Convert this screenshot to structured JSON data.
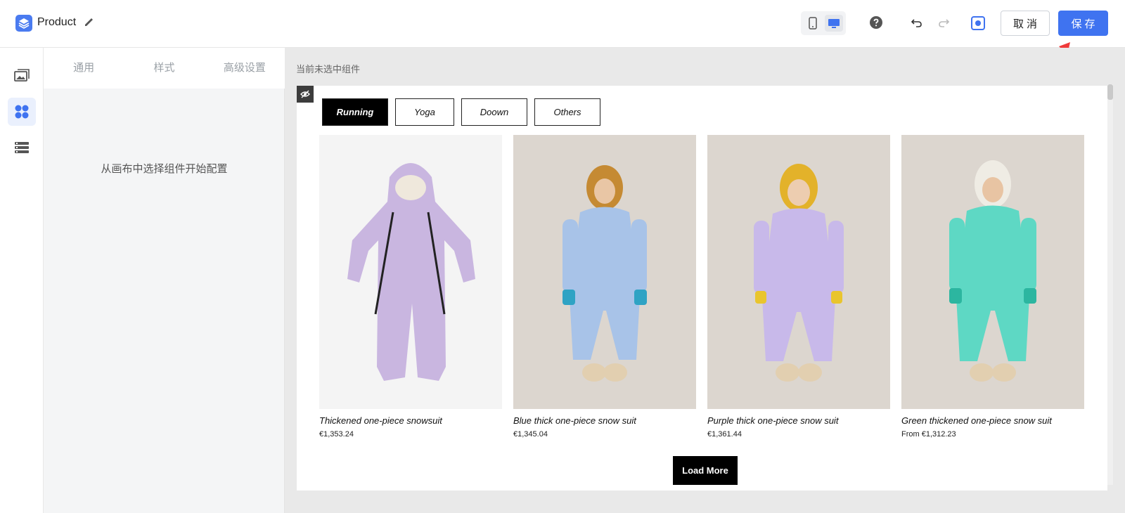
{
  "header": {
    "title": "Product",
    "cancel_label": "取消",
    "save_label": "保存"
  },
  "panel": {
    "tabs": [
      "通用",
      "样式",
      "高级设置"
    ],
    "hint": "从画布中选择组件开始配置"
  },
  "canvas": {
    "status": "当前未选中组件",
    "category_tabs": [
      "Running",
      "Yoga",
      "Doown",
      "Others"
    ],
    "active_category": "Running",
    "products": [
      {
        "title": "Thickened one-piece snowsuit",
        "price": "€1,353.24",
        "color": "#c9b6e0"
      },
      {
        "title": "Blue thick one-piece snow suit",
        "price": "€1,345.04",
        "color": "#a8c3e8"
      },
      {
        "title": "Purple thick one-piece snow suit",
        "price": "€1,361.44",
        "color": "#c8b9ea"
      },
      {
        "title": "Green thickened one-piece snow suit",
        "price": "From €1,312.23",
        "color": "#5ed8c4"
      }
    ],
    "load_more_label": "Load More"
  },
  "colors": {
    "accent": "#3f73f0",
    "arrow": "#ef3b3b"
  }
}
